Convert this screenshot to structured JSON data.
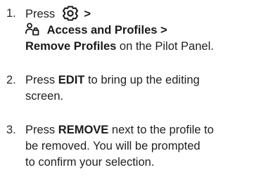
{
  "steps": [
    {
      "number": "1.",
      "line1_text": "Press",
      "line1_icon": "gear-icon",
      "line1_sep": ">",
      "line2_icon": "profile-lock-icon",
      "line2_bold": "Access and Profiles",
      "line2_sep": ">",
      "line3_bold": "Remove Profiles",
      "line3_text": "on the Pilot Panel."
    },
    {
      "number": "2.",
      "pre": "Press",
      "bold": "EDIT",
      "post": "to bring up the editing",
      "cont": "screen."
    },
    {
      "number": "3.",
      "pre": "Press",
      "bold": "REMOVE",
      "post": "next to the profile to",
      "cont1": "be removed. You will be prompted",
      "cont2": "to confirm your selection."
    }
  ]
}
